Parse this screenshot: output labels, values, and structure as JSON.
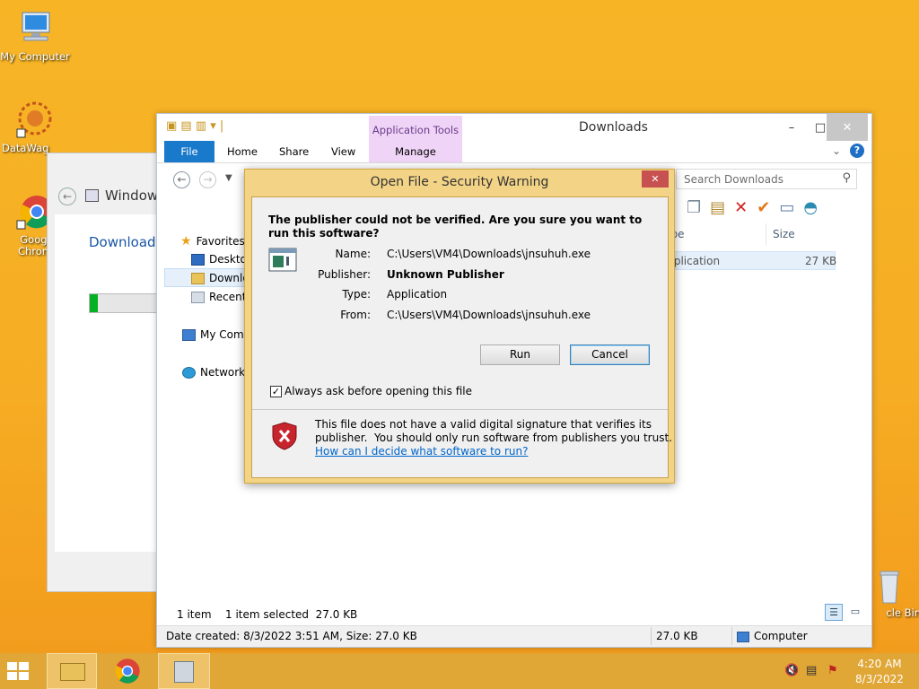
{
  "desktop": {
    "icons": [
      {
        "label": "My Computer"
      },
      {
        "label": "DataWagon"
      },
      {
        "label": "Google Chrome",
        "line1": "Googl",
        "line2": "Chrom"
      },
      {
        "label": "Recycle Bin",
        "visible": "cle Bin"
      }
    ]
  },
  "bg_window": {
    "title": "Windows",
    "heading": "Downloadi",
    "progress": 0.1
  },
  "explorer": {
    "title": "Downloads",
    "context_tab_group": "Application Tools",
    "tabs": [
      "File",
      "Home",
      "Share",
      "View",
      "Manage"
    ],
    "search_placeholder": "Search Downloads",
    "nav": {
      "favorites": "Favorites",
      "desktop": "Desktop",
      "downloads": "Downloads",
      "recent": "Recent places",
      "computer": "My Computer",
      "network": "Network"
    },
    "columns": {
      "type": "Type",
      "size": "Size"
    },
    "file_row": {
      "type": "Application",
      "size": "27 KB"
    },
    "status": {
      "items": "1 item",
      "selected": "1 item selected  27.0 KB"
    },
    "details_bar": {
      "info": "Date created: 8/3/2022 3:51 AM, Size: 27.0 KB",
      "size": "27.0 KB",
      "location": "Computer"
    }
  },
  "dialog": {
    "title": "Open File - Security Warning",
    "question": "The publisher could not be verified.  Are you sure you want to run this software?",
    "fields": [
      {
        "label": "Name:",
        "value": "C:\\Users\\VM4\\Downloads\\jnsuhuh.exe"
      },
      {
        "label": "Publisher:",
        "value": "Unknown Publisher"
      },
      {
        "label": "Type:",
        "value": "Application"
      },
      {
        "label": "From:",
        "value": "C:\\Users\\VM4\\Downloads\\jnsuhuh.exe"
      }
    ],
    "run_label": "Run",
    "cancel_label": "Cancel",
    "checkbox_label": "Always ask before opening this file",
    "checkbox_checked": true,
    "warning_line1": "This file does not have a valid digital signature that verifies its",
    "warning_line2": "publisher.  You should only run software from publishers you trust.",
    "help_link": "How can I decide what software to run?"
  },
  "taskbar": {
    "time": "4:20 AM",
    "date": "8/3/2022"
  },
  "colors": {
    "accent": "#1979ca",
    "dialog_frame": "#f3d386",
    "close_red": "#c75050",
    "taskbar": "#e0a636"
  }
}
